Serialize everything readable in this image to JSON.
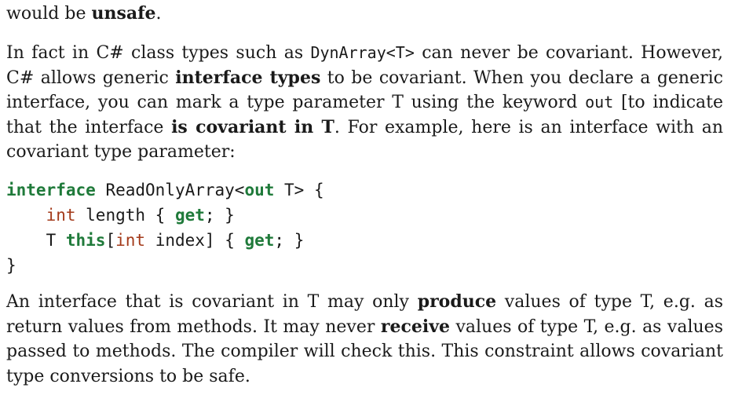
{
  "para0": {
    "t1": "would be ",
    "b1": "unsafe",
    "t2": "."
  },
  "para1": {
    "t1": "In fact in C# class types such as ",
    "code1": "DynArray<T>",
    "t2": " can never be covariant. However, C# allows generic ",
    "b1": "interface types",
    "t3": " to be covariant. When you declare a generic interface, you can mark a type parameter T using the keyword ",
    "code2": "out",
    "t4": " [to indicate that the interface ",
    "b2": "is covariant in T",
    "t5": ". For example, here is an interface with an covariant type parameter:"
  },
  "code": {
    "line1": {
      "kw_interface": "interface",
      "rest1": " ReadOnlyArray<",
      "kw_out": "out",
      "rest2": " T> {"
    },
    "line2": {
      "indent": "    ",
      "kw_int": "int",
      "rest1": " length { ",
      "kw_get": "get",
      "rest2": "; }"
    },
    "line3": {
      "indent": "    ",
      "t": "T ",
      "kw_this": "this",
      "bracket": "[",
      "kw_int": "int",
      "rest1": " index] { ",
      "kw_get": "get",
      "rest2": "; }"
    },
    "line4": {
      "brace": "}"
    }
  },
  "para2": {
    "t1": "An interface that is covariant in T may only ",
    "b1": "produce",
    "t2": " values of type T, e.g. as return values from methods. It may never ",
    "b2": "receive",
    "t3": " values of type T, e.g. as values passed to methods. The compiler will check this. This constraint allows covariant type conversions to be safe."
  },
  "colors": {
    "keyword_green": "#1f7a3a",
    "keyword_red": "#a33a1a",
    "text": "#1a1a1a"
  }
}
